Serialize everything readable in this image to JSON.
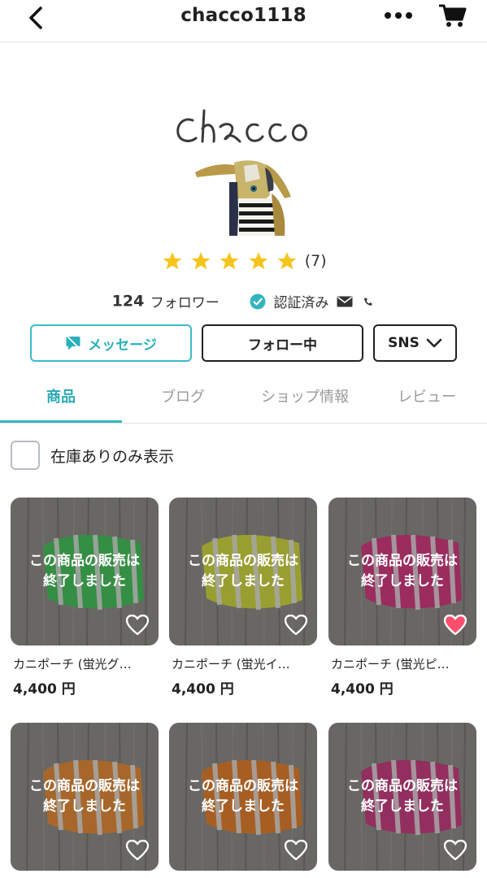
{
  "header": {
    "title": "chacco1118"
  },
  "shop": {
    "logo_text": "chacco",
    "rating_count": "(7)",
    "rating_stars": 5,
    "follower_count": "124",
    "follower_label": "フォロワー",
    "verified_label": "認証済み"
  },
  "actions": {
    "message_label": "メッセージ",
    "follow_label": "フォロー中",
    "sns_label": "SNS"
  },
  "tabs": [
    {
      "label": "商品",
      "active": true
    },
    {
      "label": "ブログ",
      "active": false
    },
    {
      "label": "ショップ情報",
      "active": false
    },
    {
      "label": "レビュー",
      "active": false
    }
  ],
  "filter": {
    "stock_only_label": "在庫ありのみ表示",
    "checked": false
  },
  "products": [
    {
      "name": "カニポーチ (蛍光グ…",
      "price": "4,400 円",
      "sold_text": "この商品の販売は\n終了しました",
      "favorited": false,
      "color": "#2fd24a"
    },
    {
      "name": "カニポーチ (蛍光イ…",
      "price": "4,400 円",
      "sold_text": "この商品の販売は\n終了しました",
      "favorited": false,
      "color": "#e6ee28"
    },
    {
      "name": "カニポーチ (蛍光ピ…",
      "price": "4,400 円",
      "sold_text": "この商品の販売は\n終了しました",
      "favorited": true,
      "color": "#e8207a"
    },
    {
      "name": "",
      "price": "",
      "sold_text": "この商品の販売は\n終了しました",
      "favorited": false,
      "color": "#ff8a1e"
    },
    {
      "name": "",
      "price": "",
      "sold_text": "この商品の販売は\n終了しました",
      "favorited": false,
      "color": "#ff7a10"
    },
    {
      "name": "",
      "price": "",
      "sold_text": "この商品の販売は\n終了しました",
      "favorited": false,
      "color": "#d9267a"
    }
  ],
  "colors": {
    "accent": "#33b5c0",
    "star": "#f5c51d",
    "favorite_active": "#ff4f6d"
  }
}
